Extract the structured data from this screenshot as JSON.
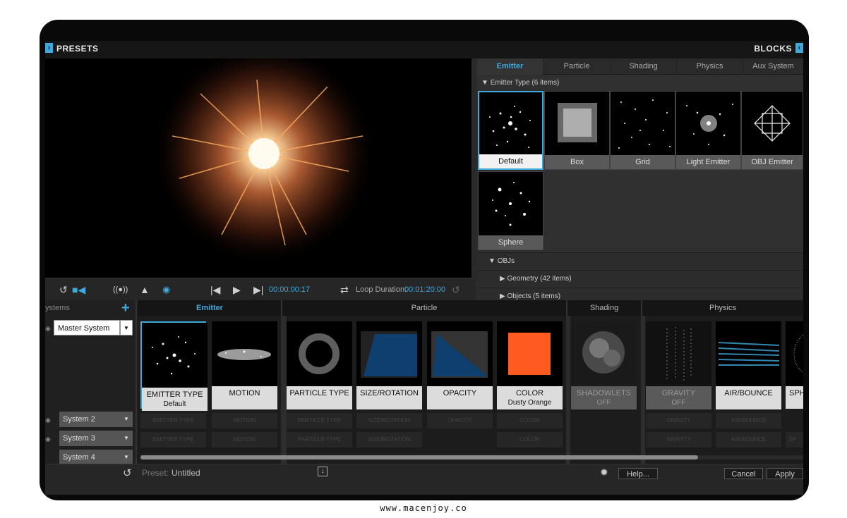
{
  "header": {
    "left_title": "PRESETS",
    "right_title": "BLOCKS"
  },
  "transport": {
    "timecode": "00:00:00:17",
    "loop_label": "Loop Duration:",
    "loop_value": "00:01:20:00"
  },
  "right_panel": {
    "tabs": [
      "Emitter",
      "Particle",
      "Shading",
      "Physics",
      "Aux System"
    ],
    "emitter_type_label": "Emitter Type  (6 items)",
    "tiles": [
      "Default",
      "Box",
      "Grid",
      "Light Emitter",
      "OBJ Emitter",
      "Sphere"
    ],
    "objs_label": "OBJs",
    "geometry_label": "Geometry  (42 items)",
    "objects_label": "Objects  (5 items)"
  },
  "systems": {
    "header": "ystems",
    "master": "Master System",
    "items": [
      "System 2",
      "System 3",
      "System 4"
    ]
  },
  "sections": {
    "emitter": "Emitter",
    "particle": "Particle",
    "shading": "Shading",
    "physics": "Physics"
  },
  "cards": [
    {
      "title": "EMITTER TYPE",
      "sub": "Default"
    },
    {
      "title": "MOTION",
      "sub": ""
    },
    {
      "title": "PARTICLE TYPE",
      "sub": ""
    },
    {
      "title": "SIZE/ROTATION",
      "sub": ""
    },
    {
      "title": "OPACITY",
      "sub": ""
    },
    {
      "title": "COLOR",
      "sub": "Dusty Orange"
    },
    {
      "title": "SHADOWLETS",
      "sub": "OFF"
    },
    {
      "title": "GRAVITY",
      "sub": "OFF"
    },
    {
      "title": "AIR/BOUNCE",
      "sub": ""
    },
    {
      "title": "SPH",
      "sub": ""
    }
  ],
  "ghosts": [
    "EMITTER TYPE",
    "MOTION",
    "PARTICLE TYPE",
    "SIZE/ROTATION",
    "OPACITY",
    "COLOR",
    "GRAVITY",
    "AIR/BOUNCE",
    "SP"
  ],
  "footer": {
    "preset_label": "Preset:",
    "preset_value": "Untitled",
    "help": "Help...",
    "cancel": "Cancel",
    "apply": "Apply"
  },
  "watermark": "www.macenjoy.co",
  "colors": {
    "accent": "#3fa8dc",
    "swatch": "#ff5a1f",
    "blue_shape": "#0f3f6e"
  }
}
